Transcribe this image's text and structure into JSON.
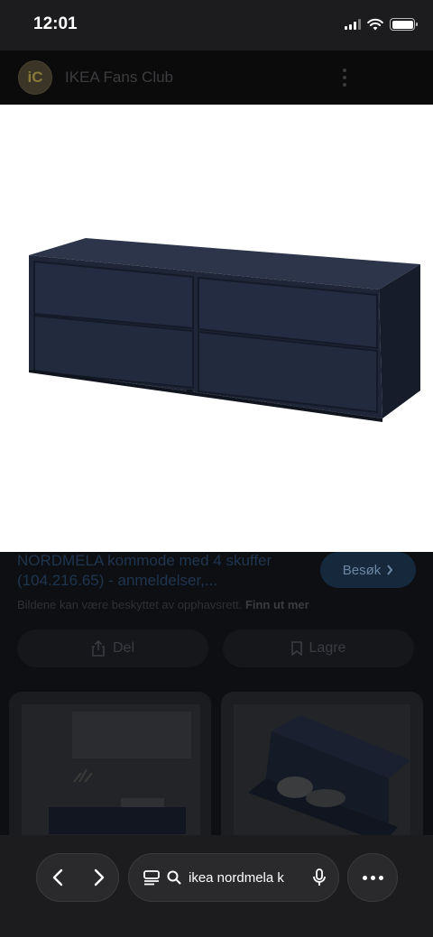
{
  "status_bar": {
    "time": "12:01"
  },
  "site_header": {
    "logo_text": "iC",
    "title": "IKEA Fans Club"
  },
  "result": {
    "title": "NORDMELA kommode med 4 skuffer (104.216.65) - anmeldelser,...",
    "visit_label": "Besøk",
    "copyright_text": "Bildene kan være beskyttet av opphavsrett.",
    "learn_more": "Finn ut mer",
    "share_label": "Del",
    "save_label": "Lagre"
  },
  "browser": {
    "address_text": "ikea nordmela k"
  },
  "colors": {
    "furniture": "#1e2638",
    "background": "#000000",
    "toolbar": "#1c1c1e"
  }
}
